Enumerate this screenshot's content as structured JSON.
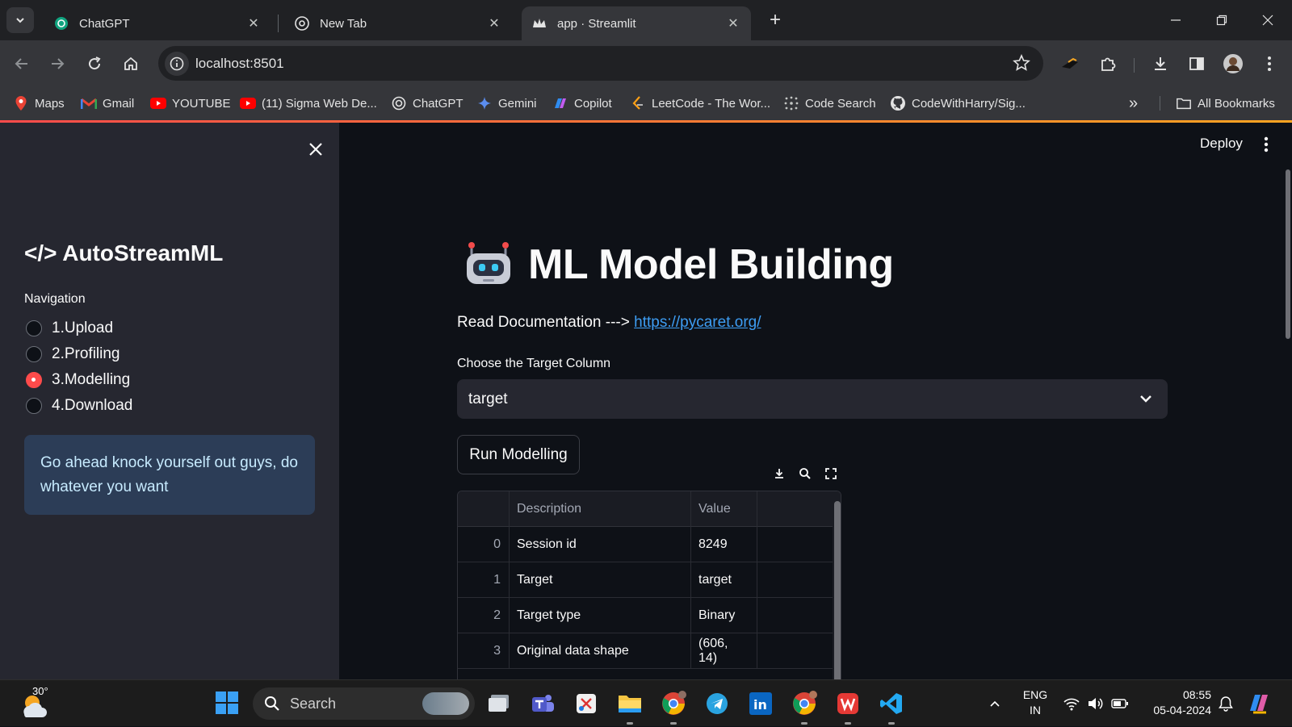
{
  "browser": {
    "tabs": [
      {
        "title": "ChatGPT",
        "active": false
      },
      {
        "title": "New Tab",
        "active": false
      },
      {
        "title": "app · Streamlit",
        "active": true
      }
    ],
    "url": "localhost:8501",
    "bookmarks": [
      {
        "label": "Maps",
        "icon": "maps-pin-icon"
      },
      {
        "label": "Gmail",
        "icon": "gmail-icon"
      },
      {
        "label": "YOUTUBE",
        "icon": "youtube-icon"
      },
      {
        "label": "(11) Sigma Web De...",
        "icon": "youtube-icon"
      },
      {
        "label": "ChatGPT",
        "icon": "chatgpt-icon"
      },
      {
        "label": "Gemini",
        "icon": "gemini-icon"
      },
      {
        "label": "Copilot",
        "icon": "copilot-icon"
      },
      {
        "label": "LeetCode - The Wor...",
        "icon": "leetcode-icon"
      },
      {
        "label": "Code Search",
        "icon": "code-search-icon"
      },
      {
        "label": "CodeWithHarry/Sig...",
        "icon": "github-icon"
      }
    ],
    "all_bookmarks_label": "All Bookmarks"
  },
  "sidebar": {
    "title": "</> AutoStreamML",
    "nav_label": "Navigation",
    "options": [
      "1.Upload",
      "2.Profiling",
      "3.Modelling",
      "4.Download"
    ],
    "selected": "3.Modelling",
    "info": "Go ahead knock yourself out guys, do whatever you want"
  },
  "header": {
    "deploy_label": "Deploy"
  },
  "main": {
    "title": "ML Model Building",
    "doc_prefix": "Read Documentation --->",
    "doc_link": "https://pycaret.org/",
    "target_label": "Choose the Target Column",
    "target_value": "target",
    "run_button": "Run Modelling",
    "table": {
      "columns": [
        "",
        "Description",
        "Value"
      ],
      "rows": [
        {
          "index": "0",
          "description": "Session id",
          "value": "8249"
        },
        {
          "index": "1",
          "description": "Target",
          "value": "target"
        },
        {
          "index": "2",
          "description": "Target type",
          "value": "Binary"
        },
        {
          "index": "3",
          "description": "Original data shape",
          "value": "(606, 14)"
        }
      ]
    }
  },
  "taskbar": {
    "weather_temp": "30°",
    "search_placeholder": "Search",
    "language": [
      "ENG",
      "IN"
    ],
    "time": "08:55",
    "date": "05-04-2024"
  },
  "colors": {
    "accent": "#ff4b4b",
    "link": "#3d9df3",
    "app_bg": "#0e1117",
    "sidebar_bg": "#262730",
    "info_bg": "#2c3d57"
  }
}
